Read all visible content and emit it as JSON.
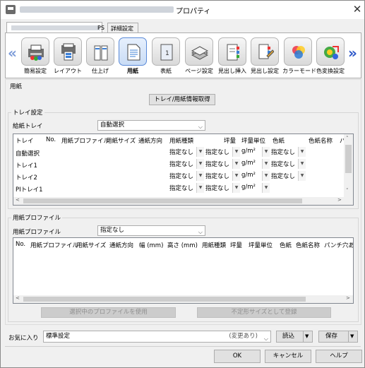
{
  "window": {
    "title": "プロパティ"
  },
  "tabs": [
    {
      "label": "PS"
    },
    {
      "label": "詳細設定"
    }
  ],
  "functions": [
    {
      "label": "簡易設定",
      "icon": "quick-settings-icon"
    },
    {
      "label": "レイアウト",
      "icon": "layout-icon"
    },
    {
      "label": "仕上げ",
      "icon": "finishing-icon"
    },
    {
      "label": "用紙",
      "icon": "paper-icon",
      "selected": true
    },
    {
      "label": "表紙",
      "icon": "cover-icon"
    },
    {
      "label": "ページ設定",
      "icon": "page-setup-icon"
    },
    {
      "label": "見出し挿入",
      "icon": "tab-insert-icon"
    },
    {
      "label": "見出し設定",
      "icon": "tab-setting-icon"
    },
    {
      "label": "カラーモード",
      "icon": "color-mode-icon"
    },
    {
      "label": "色変換設定",
      "icon": "color-conversion-icon"
    }
  ],
  "paper": {
    "section_label": "用紙",
    "get_info_button": "トレイ/用紙情報取得",
    "tray_group": "トレイ設定",
    "feed_tray_label": "給紙トレイ",
    "feed_tray_value": "自動選択",
    "tray_columns": [
      "トレイ",
      "No.",
      "用紙プロファイル",
      "用紙サイズ",
      "通紙方向",
      "用紙種類",
      "坪量",
      "坪量単位",
      "色紙",
      "色紙名称",
      "パ"
    ],
    "tray_rows": [
      {
        "tray": "自動選択",
        "type": "指定なし",
        "weight": "指定なし",
        "unit": "g/m²",
        "color": "指定なし"
      },
      {
        "tray": "トレイ1",
        "type": "指定なし",
        "weight": "指定なし",
        "unit": "g/m²",
        "color": "指定なし"
      },
      {
        "tray": "トレイ2",
        "type": "指定なし",
        "weight": "指定なし",
        "unit": "g/m²",
        "color": "指定なし"
      },
      {
        "tray": "PIトレイ1",
        "type": "指定なし",
        "weight": "指定なし",
        "unit": "g/m²",
        "color": ""
      }
    ],
    "profile_group": "用紙プロファイル",
    "profile_label": "用紙プロファイル",
    "profile_value": "指定なし",
    "profile_columns": [
      "No.",
      "用紙プロファイル",
      "用紙サイズ",
      "通紙方向",
      "幅 (mm)",
      "高さ (mm)",
      "用紙種類",
      "坪量",
      "坪量単位",
      "色紙",
      "色紙名称",
      "パンチ穴あ"
    ],
    "use_profile_button": "選択中のプロファイルを使用",
    "register_custom_button": "不定形サイズとして登録"
  },
  "favorites": {
    "label": "お気に入り",
    "value": "標準設定",
    "changed": "(変更あり)",
    "load_button": "読込",
    "save_button": "保存"
  },
  "footer": {
    "ok": "OK",
    "cancel": "キャンセル",
    "help": "ヘルプ"
  }
}
